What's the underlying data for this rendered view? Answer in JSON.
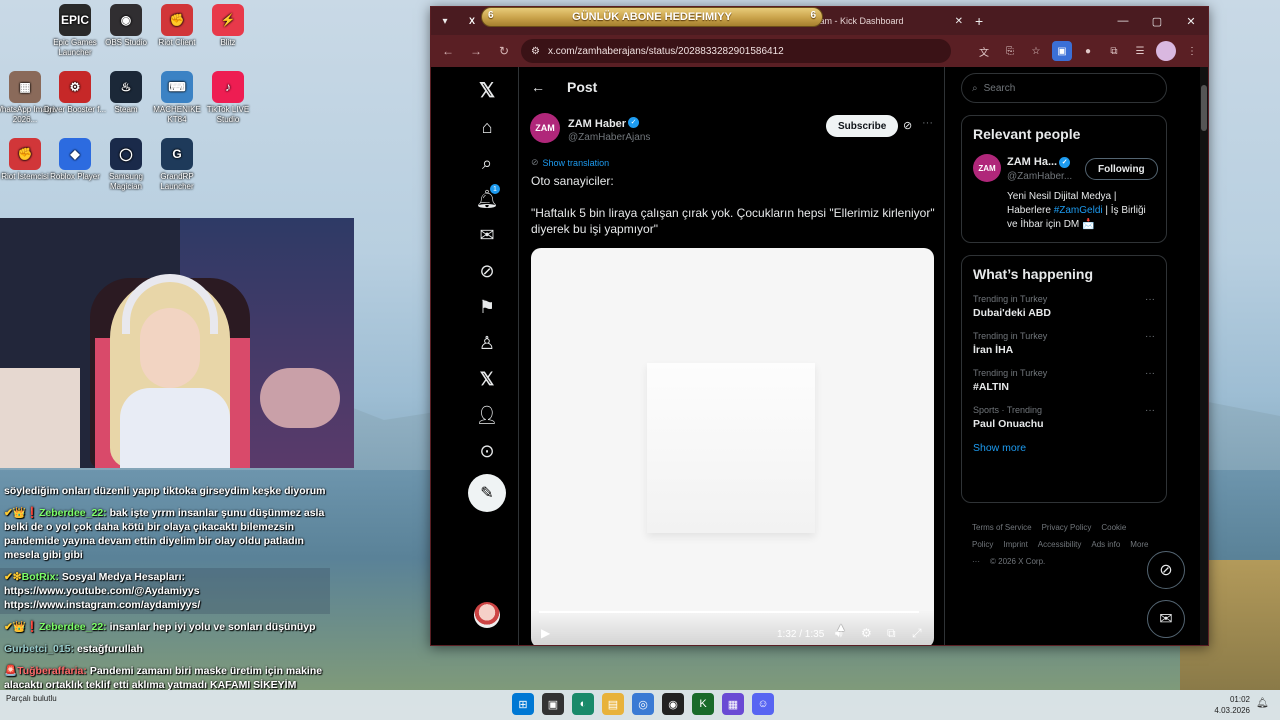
{
  "desktop": {
    "icons": [
      {
        "label": "Epic Games Launcher",
        "glyph": "EPIC",
        "color": "#2a2a2a"
      },
      {
        "label": "OBS Studio",
        "glyph": "◉",
        "color": "#302e31"
      },
      {
        "label": "Riot Client",
        "glyph": "✊",
        "color": "#d13639"
      },
      {
        "label": "Blitz",
        "glyph": "⚡",
        "color": "#e8394a"
      },
      {
        "label": "WhatsApp Image 2026...",
        "glyph": "▦",
        "color": "#8a6a5a"
      },
      {
        "label": "Driver Booster f...",
        "glyph": "⚙",
        "color": "#c62828"
      },
      {
        "label": "Steam",
        "glyph": "♨",
        "color": "#1b2838"
      },
      {
        "label": "MACHENIKE KT84",
        "glyph": "⌨",
        "color": "#3b82c4"
      },
      {
        "label": "TikTok LIVE Studio",
        "glyph": "♪",
        "color": "#ee1d52"
      },
      {
        "label": "Riot İstemcisi",
        "glyph": "✊",
        "color": "#d13639"
      },
      {
        "label": "Roblox Player",
        "glyph": "◆",
        "color": "#2c6be0"
      },
      {
        "label": "Samsung Magician",
        "glyph": "◯",
        "color": "#1a2a4a"
      },
      {
        "label": "GrandRP Launcher",
        "glyph": "G",
        "color": "#1e3a5a"
      }
    ]
  },
  "chat": {
    "messages": [
      {
        "user": "",
        "text": "söylediğim onları düzenli yapıp tiktoka girseydim keşke diyorum",
        "badges": "",
        "hl": false,
        "ucls": ""
      },
      {
        "user": "Zeberdee_22:",
        "text": " bak işte yrrm insanlar şunu düşünmez asla belki de o yol çok daha kötü bir olaya çıkacaktı bilemezsin pandemide yayına devam ettin diyelim bir olay oldu patladın mesela gibi gibi",
        "badges": "✔👑❗",
        "hl": false,
        "ucls": ""
      },
      {
        "user": "BotRix:",
        "text": " Sosyal Medya Hesapları: https://www.youtube.com/@Aydamiyys https://www.instagram.com/aydamiyys/",
        "badges": "✔❇",
        "hl": true,
        "ucls": "bot"
      },
      {
        "user": "Zeberdee_22:",
        "text": " insanlar hep iyi yolu ve sonları düşünüyp",
        "badges": "✔👑❗",
        "hl": false,
        "ucls": ""
      },
      {
        "user": "Gurbetci_015:",
        "text": " estağfurullah",
        "badges": "",
        "hl": false,
        "ucls": "gray"
      },
      {
        "user": "Tuğberaffaria:",
        "text": " Pandemi zamanı biri maske üretim için makine alacaktı ortaklık teklif etti aklıma yatmadı KAFAMI SİKEYİM",
        "badges": "🚨",
        "hl": false,
        "ucls": "red"
      }
    ]
  },
  "overlay": {
    "title": "GÜNLÜK ABONE HEDEFIMIYY",
    "left_num": "6",
    "right_num": "6"
  },
  "browser": {
    "tabs": [
      {
        "label": "",
        "icon": "X"
      },
      {
        "label": "tream - Kick Dashboard",
        "icon": ""
      }
    ],
    "new_tab": "+",
    "url": "x.com/zamhaberajans/status/2028833282901586412",
    "window_controls": {
      "minimize": "—",
      "maximize": "▢",
      "close": "✕"
    }
  },
  "x": {
    "nav_badge": "1",
    "header": "Post",
    "post": {
      "author_name": "ZAM Haber",
      "author_handle": "@ZamHaberAjans",
      "avatar_text": "ZAM",
      "subscribe": "Subscribe",
      "translate": "Show translation",
      "text_line1": "Oto sanayiciler:",
      "text_line2": "\"Haftalık 5 bin liraya çalışan çırak yok. Çocukların hepsi \"Ellerimiz kirleniyor\" diyerek bu işi yapmıyor\"",
      "video_time": "1:32 / 1:35"
    },
    "right": {
      "search_placeholder": "Search",
      "relevant_title": "Relevant people",
      "person": {
        "name": "ZAM Ha...",
        "handle": "@ZamHaber...",
        "avatar_text": "ZAM",
        "follow": "Following",
        "bio_pre": "Yeni Nesil Dijital Medya | Haberlere ",
        "bio_tag": "#ZamGeldi",
        "bio_post": " | İş Birliği ve İhbar için DM 📩"
      },
      "happening_title": "What’s happening",
      "trends": [
        {
          "context": "Trending in Turkey",
          "title": "Dubai'deki ABD"
        },
        {
          "context": "Trending in Turkey",
          "title": "İran İHA"
        },
        {
          "context": "Trending in Turkey",
          "title": "#ALTIN"
        },
        {
          "context": "Sports · Trending",
          "title": "Paul Onuachu"
        }
      ],
      "show_more": "Show more",
      "footer": [
        "Terms of Service",
        "Privacy Policy",
        "Cookie Policy",
        "Imprint",
        "Accessibility",
        "Ads info",
        "More ···",
        "© 2026 X Corp."
      ]
    }
  },
  "taskbar": {
    "weather": "Parçalı bulutlu",
    "time": "01:02",
    "date": "4.03.2026"
  }
}
